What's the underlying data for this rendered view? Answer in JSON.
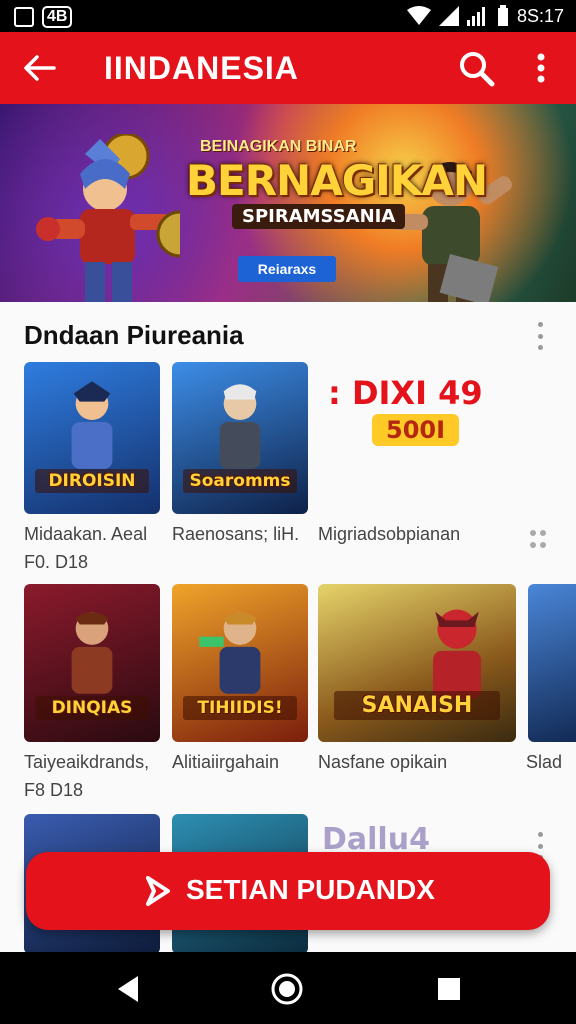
{
  "status_bar": {
    "left_badge": "4B",
    "time": "8S:17"
  },
  "app_bar": {
    "title": "IINDANESIA"
  },
  "banner": {
    "top_text": "BEINAGIKAN BINAR",
    "headline": "BERNAGIKAN",
    "subline": "SPIRAMSSANIA",
    "button": "Reiaraxs"
  },
  "section": {
    "title": "Dndaan Piureania",
    "promo_text": ": DIXI 49",
    "promo_badge": "500I"
  },
  "games": {
    "row1": [
      {
        "logo": "DIROISIN",
        "label": "Midaakan. Aeal",
        "sublabel": "F0. D18",
        "accent": "#2f7de0"
      },
      {
        "logo": "Soaromms",
        "label": "Raenosans; liH.",
        "sublabel": "",
        "accent": "#1b4c9b"
      }
    ],
    "row1_third_label": "Migriadsobpianan",
    "row2": [
      {
        "logo": "DINQIAS",
        "label": "Taiyeaikdrands,",
        "sublabel": "F8 D18",
        "accent": "#8b1a2c"
      },
      {
        "logo": "TIHIIDIS!",
        "label": "Alitiaiirgahain",
        "sublabel": "",
        "accent": "#e8831c"
      },
      {
        "logo": "SANAISH",
        "label": "Nasfane opikain",
        "sublabel": "",
        "accent": "#c6b23d"
      },
      {
        "logo": "",
        "label": "Slad",
        "sublabel": "",
        "accent": "#2b5fa8"
      }
    ],
    "row3_partial_text": "Dallu4"
  },
  "fab": {
    "label": "SETIAN PUDANDX"
  },
  "colors": {
    "primary": "#e3121b",
    "badge": "#ffc928"
  }
}
